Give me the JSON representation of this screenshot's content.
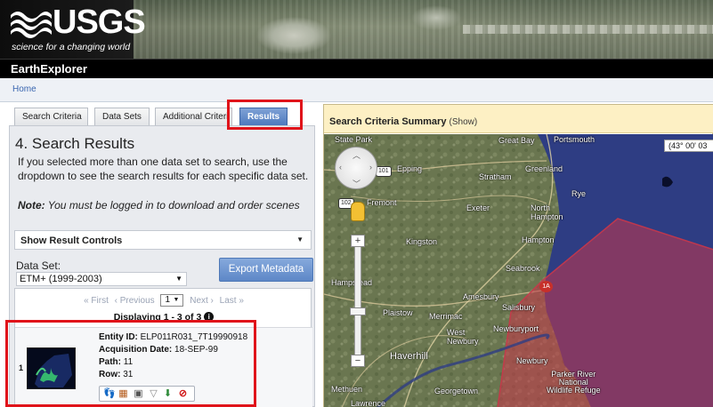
{
  "header": {
    "logo_text": "USGS",
    "tagline": "science for a changing world",
    "app_title": "EarthExplorer"
  },
  "breadcrumb": {
    "home": "Home"
  },
  "tabs": [
    {
      "label": "Search Criteria",
      "active": false
    },
    {
      "label": "Data Sets",
      "active": false
    },
    {
      "label": "Additional Criteri",
      "active": false
    },
    {
      "label": "Results",
      "active": true
    }
  ],
  "results": {
    "title": "4. Search Results",
    "description": "If you selected more than one data set to search, use the dropdown to see the search results for each specific data set.",
    "note_label": "Note:",
    "note_text": " You must be logged in to download and order scenes",
    "result_controls": "Show Result Controls",
    "dataset_label": "Data Set:",
    "dataset_value": "ETM+ (1999-2003)",
    "export_button": "Export Metadata",
    "pager": {
      "first": "« First",
      "previous": "‹ Previous",
      "page": "1",
      "next": "Next ›",
      "last": "Last »"
    },
    "displaying": "Displaying 1 - 3 of 3",
    "rows": [
      {
        "number": "1",
        "entity_id_label": "Entity ID:",
        "entity_id": "ELP011R031_7T19990918",
        "acq_date_label": "Acquisition Date:",
        "acq_date": "18-SEP-99",
        "path_label": "Path:",
        "path": "11",
        "row_label": "Row:",
        "row": "31"
      }
    ],
    "row_tools": [
      "footprint-icon",
      "browse-overlay-icon",
      "compare-icon",
      "metadata-icon",
      "download-icon",
      "exclude-icon"
    ]
  },
  "map": {
    "header_title": "Search Criteria Summary",
    "header_show": "(Show)",
    "coordinate": "(43° 00' 03",
    "labels": {
      "state_park": "State Park",
      "great_bay": "Great Bay",
      "portsmouth": "Portsmouth",
      "epping": "Epping",
      "stratham": "Stratham",
      "greenland": "Greenland",
      "rye": "Rye",
      "fremont": "Fremont",
      "exeter": "Exeter",
      "north_hampton": "North\nHampton",
      "kingston": "Kingston",
      "hampton": "Hampton",
      "seabrook": "Seabrook",
      "hampstead": "Hampstead",
      "amesbury": "Amesbury",
      "salisbury": "Salisbury",
      "plaistow": "Plaistow",
      "merrimac": "Merrimac",
      "west_newbury": "West\nNewbury",
      "newburyport": "Newburyport",
      "haverhill": "Haverhill",
      "newbury": "Newbury",
      "parker_river": "Parker River\nNational\nWildlife Refuge",
      "methuen": "Methuen",
      "georgetown": "Georgetown",
      "lawrence": "Lawrence"
    },
    "routes": {
      "r101": "101",
      "r102": "102",
      "r1a": "1A"
    }
  },
  "colors": {
    "highlight": "#e0131a",
    "active_tab": "#4d79bd",
    "export_button": "#6a8fcd",
    "map_header": "#fdf0c4",
    "ocean": "#2f3f86",
    "polygon": "#c9374a"
  }
}
